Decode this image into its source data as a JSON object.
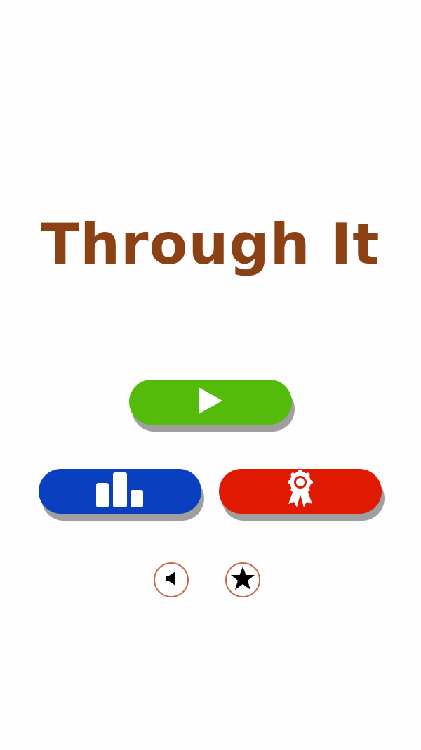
{
  "game": {
    "title": "Through It"
  },
  "colors": {
    "title": "#8b4114",
    "play_button": "#55bb0a",
    "leaderboard_button": "#0a3fbf",
    "achievements_button": "#e01a02",
    "button_shadow": "#9f9f9f",
    "circle_border": "#c8684a",
    "background": "#fefefe"
  },
  "buttons": {
    "play": {
      "icon": "play-icon"
    },
    "leaderboard": {
      "icon": "bar-chart-icon"
    },
    "achievements": {
      "icon": "award-ribbon-icon"
    },
    "sound": {
      "icon": "speaker-icon"
    },
    "rate": {
      "icon": "star-icon"
    }
  }
}
